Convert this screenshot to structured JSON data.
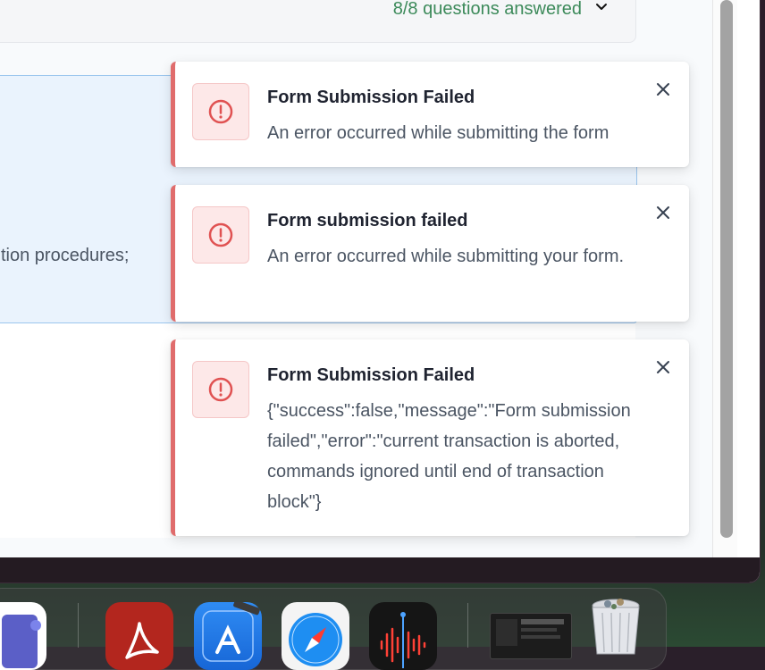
{
  "progress": {
    "text": "8/8 questions answered"
  },
  "question": {
    "fragment": "tion procedures;"
  },
  "toasts": [
    {
      "title": "Form Submission Failed",
      "message": "An error occurred while submitting the form"
    },
    {
      "title": "Form submission failed",
      "message": "An error occurred while submitting your form."
    },
    {
      "title": "Form Submission Failed",
      "message": "{\"success\":false,\"message\":\"Form submission failed\",\"error\":\"current transaction is aborted, commands ignored until end of transaction block\"}"
    }
  ],
  "icons": {
    "toast_icon": "alert-circle-icon",
    "close": "close-icon",
    "chevron": "chevron-down-icon"
  },
  "colors": {
    "error_accent": "#e06c6c",
    "error_icon": "#e05252",
    "progress_text": "#3c8a5a",
    "selected_card_bg": "#eaf3fd",
    "selected_card_border": "#9cc6ee"
  },
  "dock": {
    "apps": [
      "microsoft-teams-icon",
      "adobe-acrobat-icon",
      "xcode-icon",
      "safari-icon",
      "voice-memos-icon",
      "window-thumbnail",
      "trash-icon"
    ]
  }
}
